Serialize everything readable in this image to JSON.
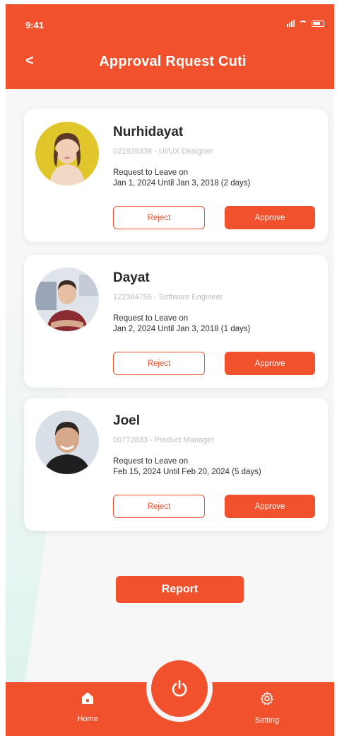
{
  "status_bar": {
    "time": "9:41"
  },
  "header": {
    "back_label": "<",
    "title": "Approval Rquest Cuti"
  },
  "requests": [
    {
      "name": "Nurhidayat",
      "meta": "021828338 - UI/UX Designer",
      "request_line1": "Request to Leave on",
      "request_line2": "Jan 1, 2024 Until Jan 3, 2018 (2 days)",
      "reject_label": "Reject",
      "approve_label": "Approve"
    },
    {
      "name": "Dayat",
      "meta": "122384755 - Software Engineer",
      "request_line1": "Request to Leave on",
      "request_line2": "Jan 2, 2024 Until Jan 3, 2018 (1 days)",
      "reject_label": "Reject",
      "approve_label": "Approve"
    },
    {
      "name": "Joel",
      "meta": "00772833 - Product Manager",
      "request_line1": "Request to Leave on",
      "request_line2": "Feb 15, 2024 Until Feb 20, 2024 (5 days)",
      "reject_label": "Reject",
      "approve_label": "Approve"
    }
  ],
  "report_label": "Report",
  "bottom_nav": {
    "home": {
      "label": "Home",
      "icon": "home-icon"
    },
    "power": {
      "icon": "power-icon"
    },
    "setting": {
      "label": "Setting",
      "icon": "gear-icon"
    }
  },
  "colors": {
    "accent": "#f2512d",
    "background": "#f7f7f7",
    "card": "#ffffff"
  }
}
